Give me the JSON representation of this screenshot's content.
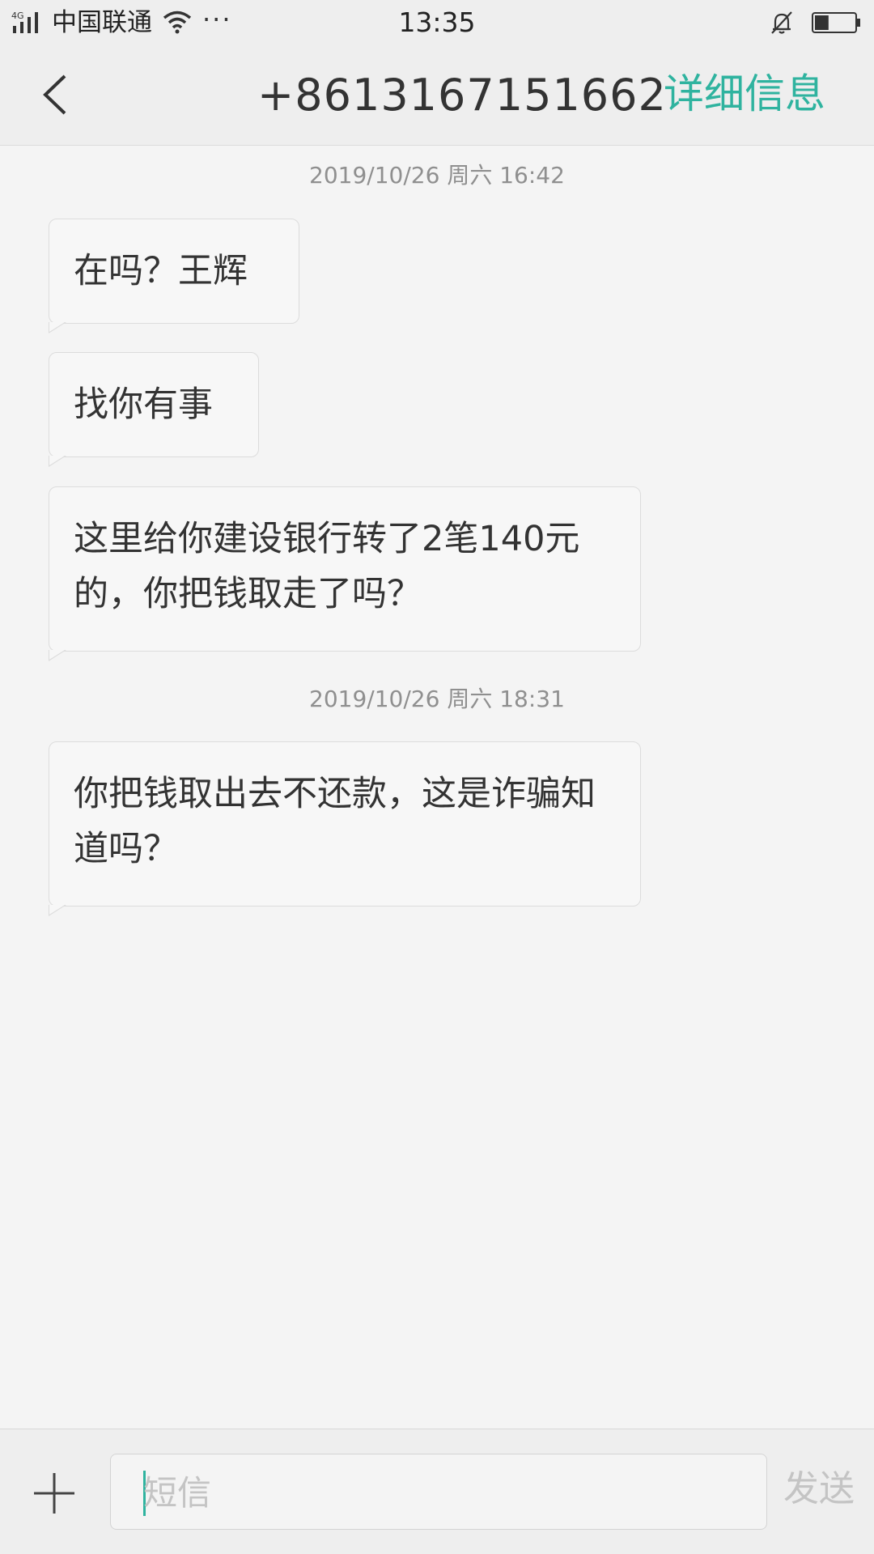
{
  "status_bar": {
    "network_type": "4G",
    "carrier": "中国联通",
    "more": "···",
    "time": "13:35",
    "battery_level": 0.35
  },
  "header": {
    "back_icon": "chevron-left-icon",
    "contact": "+8613167151662",
    "details": "详细信息"
  },
  "conversation": {
    "groups": [
      {
        "timestamp": "2019/10/26 周六  16:42",
        "messages": [
          "在吗？王辉",
          "找你有事",
          "这里给你建设银行转了2笔140元的，你把钱取走了吗？"
        ]
      },
      {
        "timestamp": "2019/10/26 周六  18:31",
        "messages": [
          "你把钱取出去不还款，这是诈骗知道吗？"
        ]
      }
    ]
  },
  "composer": {
    "add_icon": "plus-icon",
    "placeholder": "短信",
    "send": "发送"
  },
  "colors": {
    "accent": "#2fb39f",
    "background": "#f4f4f4",
    "bar": "#eeeeee"
  }
}
